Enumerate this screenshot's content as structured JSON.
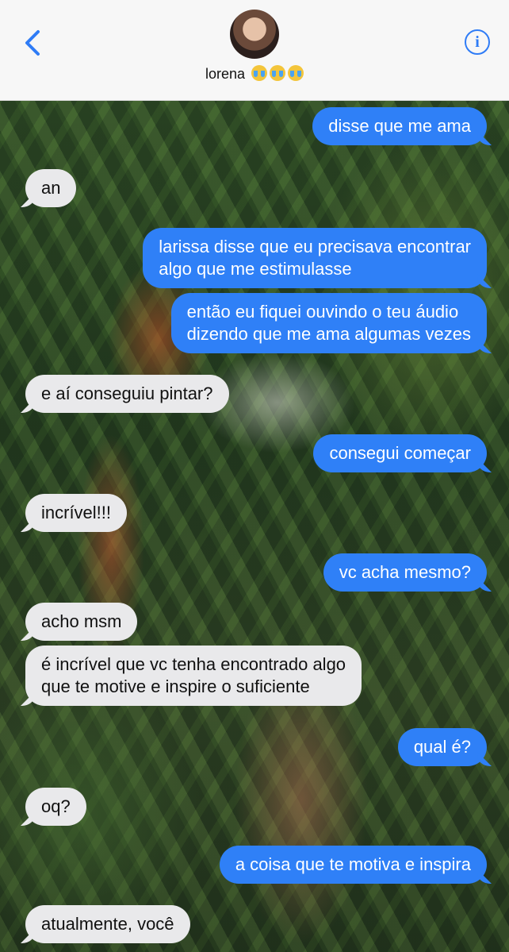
{
  "header": {
    "contact_name": "lorena",
    "contact_emojis": [
      "loudly-crying-face-emoji",
      "loudly-crying-face-emoji",
      "loudly-crying-face-emoji"
    ],
    "info_icon": "i"
  },
  "colors": {
    "outgoing_bubble": "#2f80f7",
    "incoming_bubble": "#e9e9eb",
    "accent": "#2f7cf6"
  },
  "messages": [
    {
      "from": "me",
      "text": "disse que me ama"
    },
    {
      "from": "them",
      "text": "an"
    },
    {
      "from": "me",
      "lines": [
        "larissa disse que eu precisava encontrar",
        "algo que me estimulasse"
      ]
    },
    {
      "from": "me",
      "lines": [
        "então eu fiquei ouvindo o teu áudio",
        "dizendo que me ama algumas vezes"
      ]
    },
    {
      "from": "them",
      "text": "e aí conseguiu pintar?"
    },
    {
      "from": "me",
      "text": "consegui começar"
    },
    {
      "from": "them",
      "text": "incrível!!!"
    },
    {
      "from": "me",
      "text": "vc acha mesmo?"
    },
    {
      "from": "them",
      "text": "acho msm"
    },
    {
      "from": "them",
      "lines": [
        "é incrível que vc tenha encontrado algo",
        "que te motive e inspire o suficiente"
      ]
    },
    {
      "from": "me",
      "text": "qual é?"
    },
    {
      "from": "them",
      "text": "oq?"
    },
    {
      "from": "me",
      "text": "a coisa que te motiva e inspira"
    },
    {
      "from": "them",
      "text": "atualmente, você"
    }
  ]
}
